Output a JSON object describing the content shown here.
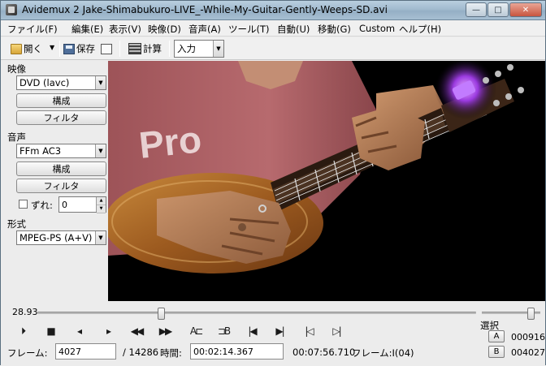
{
  "window": {
    "title": "Avidemux 2 Jake-Shimabukuro-LIVE_-While-My-Guitar-Gently-Weeps-SD.avi",
    "minimize": "—",
    "maximize": "□",
    "close": "✕"
  },
  "menu": [
    "ファイル(F)",
    "編集(E)",
    "表示(V)",
    "映像(D)",
    "音声(A)",
    "ツール(T)",
    "自動(U)",
    "移動(G)",
    "Custom",
    "ヘルプ(H)"
  ],
  "toolbar": {
    "open_label": "開く",
    "save_label": "保存",
    "calc_label": "計算",
    "input_select": "入力"
  },
  "video_section": {
    "label": "映像",
    "codec": "DVD (lavc)",
    "configure": "構成",
    "filters": "フィルタ"
  },
  "audio_section": {
    "label": "音声",
    "codec": "FFm AC3",
    "configure": "構成",
    "filters": "フィルタ",
    "shift_label": "ずれ:",
    "shift_value": "0"
  },
  "format_section": {
    "label": "形式",
    "container": "MPEG-PS (A+V)"
  },
  "playback": {
    "time_display": "28.93",
    "position_fraction": 0.282,
    "volume_fraction": 0.84,
    "selection_label": "選択",
    "marker_a": "A",
    "marker_b": "B",
    "marker_a_value": "000916",
    "marker_b_value": "004027"
  },
  "nav_buttons": [
    {
      "name": "play-icon",
      "glyph": "⏵"
    },
    {
      "name": "stop-icon",
      "glyph": "■"
    },
    {
      "name": "prev-frame-icon",
      "glyph": "◂"
    },
    {
      "name": "next-frame-icon",
      "glyph": "▸"
    },
    {
      "name": "rewind-icon",
      "glyph": "◀◀"
    },
    {
      "name": "forward-icon",
      "glyph": "▶▶"
    },
    {
      "name": "set-marker-a-icon",
      "glyph": "A⊏"
    },
    {
      "name": "set-marker-b-icon",
      "glyph": "⊐B"
    },
    {
      "name": "first-frame-icon",
      "glyph": "|◀"
    },
    {
      "name": "last-frame-icon",
      "glyph": "▶|"
    },
    {
      "name": "prev-keyframe-icon",
      "glyph": "|◁"
    },
    {
      "name": "next-keyframe-icon",
      "glyph": "▷|"
    }
  ],
  "status": {
    "frame_label": "フレーム:",
    "frame_value": "4027",
    "total_frames": "/ 14286",
    "time_label": "時間:",
    "time_value": "00:02:14.367",
    "total_time": "00:07:56.710",
    "frame_type": "フレーム:I(04)"
  },
  "video_frame": {
    "shirt_text": "Pro",
    "description_colors": {
      "shirt": "#b76a6e",
      "ukulele": "#a66a2a",
      "background": "#000000",
      "light": "#b85cff"
    }
  }
}
